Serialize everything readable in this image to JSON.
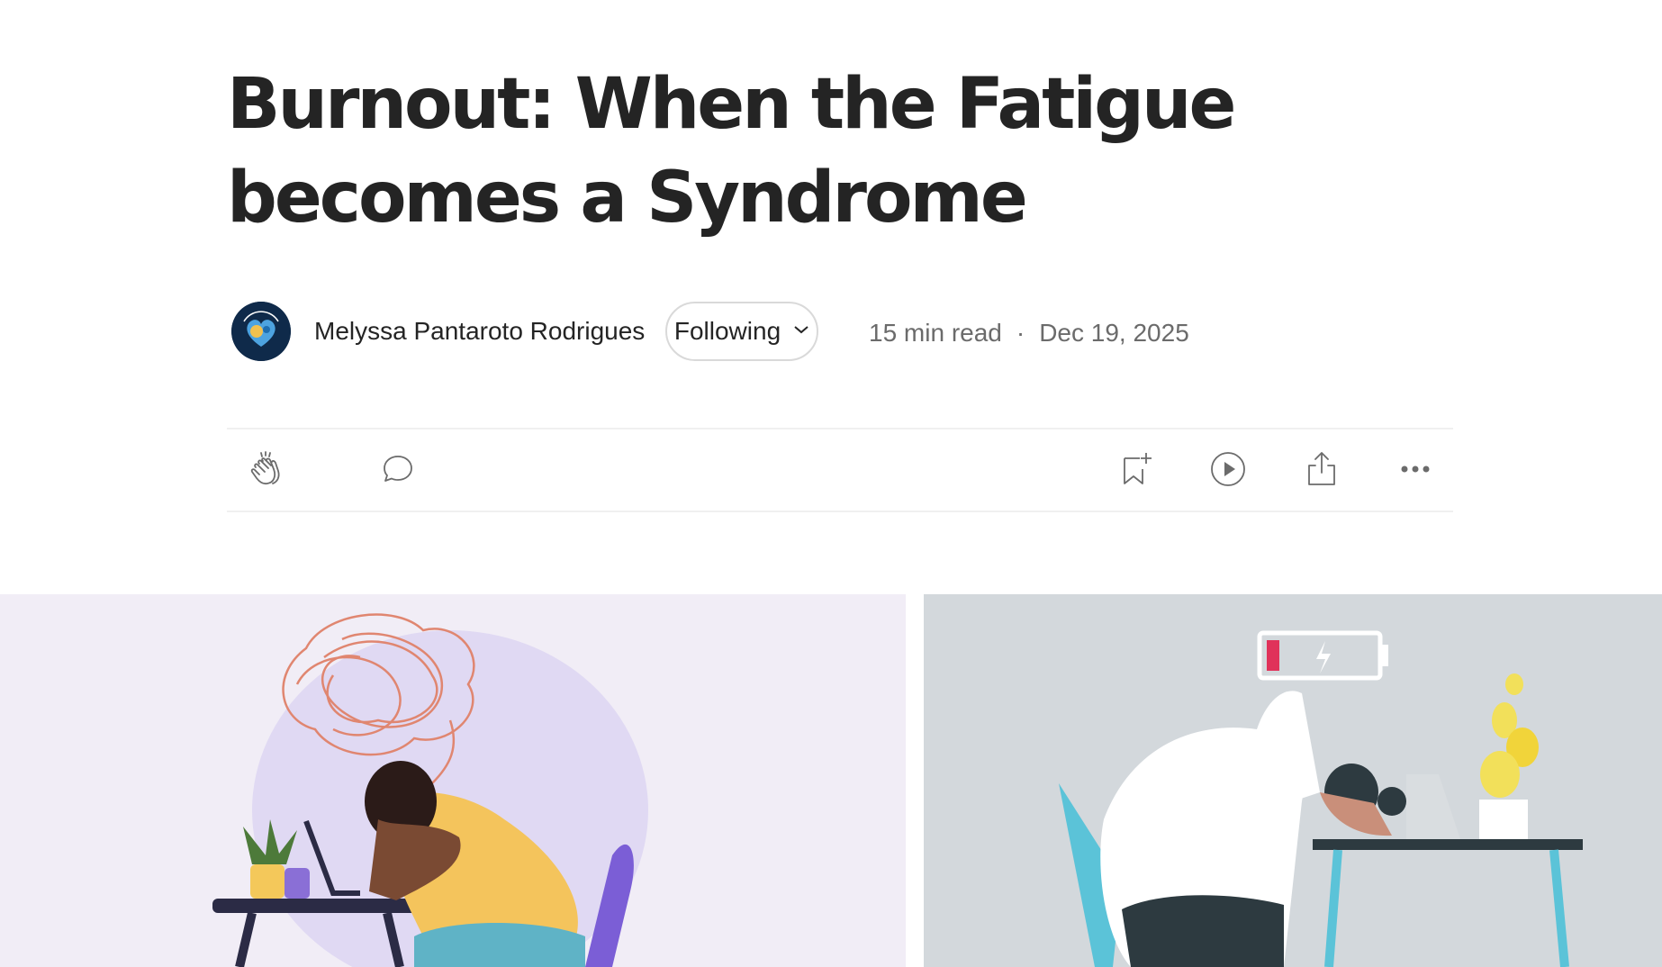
{
  "article": {
    "title_line1": "Burnout: When the Fatigue",
    "title_line2": "becomes a Syndrome"
  },
  "byline": {
    "author": "Melyssa Pantaroto Rodrigues",
    "follow_label": "Following",
    "read_time": "15 min read",
    "separator": "·",
    "date": "Dec 19, 2025"
  },
  "actions": {
    "clap_icon": "clap-icon",
    "response_icon": "speech-bubble-icon",
    "save_icon": "bookmark-plus-icon",
    "listen_icon": "play-circle-icon",
    "share_icon": "share-icon",
    "more_icon": "more-horizontal-icon"
  },
  "colors": {
    "text": "#242424",
    "meta": "#6b6b6b",
    "hero_left_bg": "#f1edf6",
    "hero_right_bg": "#d3d8dc"
  }
}
